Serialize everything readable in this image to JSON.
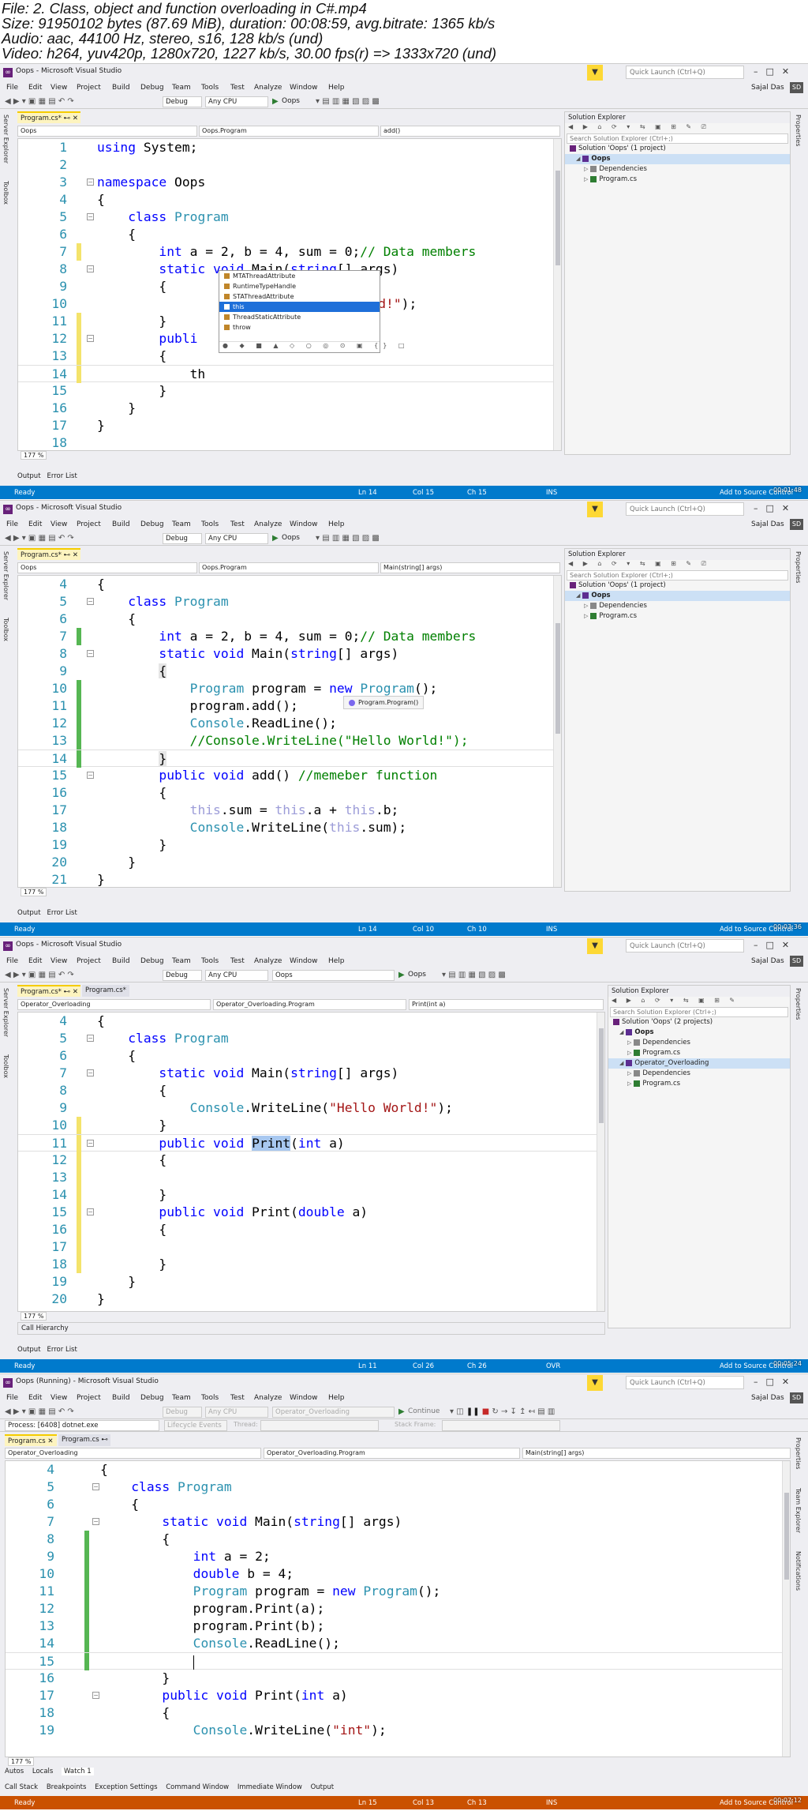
{
  "header": {
    "file": "File: 2. Class, object and function overloading in C#.mp4",
    "size": "Size: 91950102 bytes (87.69 MiB), duration: 00:08:59, avg.bitrate: 1365 kb/s",
    "audio": "Audio: aac, 44100 Hz, stereo, s16, 128 kb/s (und)",
    "video": "Video: h264, yuv420p, 1280x720, 1227 kb/s, 30.00 fps(r) => 1333x720 (und)"
  },
  "common": {
    "menu": [
      "File",
      "Edit",
      "View",
      "Project",
      "Build",
      "Debug",
      "Team",
      "Tools",
      "Test",
      "Analyze",
      "Window",
      "Help"
    ],
    "quick_launch": "Quick Launch (Ctrl+Q)",
    "user": "Sajal Das",
    "user_initials": "SD",
    "debug_config": "Debug",
    "platform": "Any CPU",
    "side_left": [
      "Server Explorer",
      "Toolbox"
    ],
    "side_right": [
      "Properties"
    ],
    "side_right_running": [
      "Properties",
      "Team Explorer",
      "Notifications"
    ],
    "se_title": "Solution Explorer",
    "se_search": "Search Solution Explorer (Ctrl+;)",
    "output_tab": "Output",
    "errorlist_tab": "Error List",
    "zoom": "177 %",
    "icons": [
      "vs-logo-icon",
      "filter-icon",
      "minimize-icon",
      "maximize-icon",
      "close-icon",
      "fold-icon"
    ],
    "colors": {
      "keyword": "#0000ff",
      "type": "#2b91af",
      "string": "#a31515",
      "comment": "#008000",
      "status_blue": "#007acc",
      "status_orange": "#ca5100"
    }
  },
  "frames": [
    {
      "title": "Oops - Microsoft Visual Studio",
      "start_target": "Oops",
      "tabs": [
        "Program.cs*"
      ],
      "nav": [
        "Oops",
        "Oops.Program",
        "add()"
      ],
      "solution": [
        "Solution 'Oops' (1 project)",
        "Oops",
        "Dependencies",
        "Program.cs"
      ],
      "status": {
        "state": "Ready",
        "ln": "Ln 14",
        "col": "Col 15",
        "ch": "Ch 15",
        "mode": "INS",
        "source": "Add to Source Control"
      },
      "timestamp": "00:01:48",
      "intellisense": [
        "MTAThreadAttribute",
        "RuntimeTypeHandle",
        "STAThreadAttribute",
        "this",
        "ThreadStaticAttribute",
        "throw"
      ]
    },
    {
      "title": "Oops - Microsoft Visual Studio",
      "start_target": "Oops",
      "tabs": [
        "Program.cs*"
      ],
      "nav": [
        "Oops",
        "Oops.Program",
        "Main(string[] args)"
      ],
      "solution": [
        "Solution 'Oops' (1 project)",
        "Oops",
        "Dependencies",
        "Program.cs"
      ],
      "status": {
        "state": "Ready",
        "ln": "Ln 14",
        "col": "Col 10",
        "ch": "Ch 10",
        "mode": "INS",
        "source": "Add to Source Control"
      },
      "timestamp": "00:03:36",
      "tooltip": "Program.Program()"
    },
    {
      "title": "Oops - Microsoft Visual Studio",
      "start_target": "Oops",
      "tabs": [
        "Program.cs*",
        "Program.cs*"
      ],
      "nav": [
        "Operator_Overloading",
        "Operator_Overloading.Program",
        "Print(int a)"
      ],
      "solution": [
        "Solution 'Oops' (2 projects)",
        "Oops",
        "Dependencies",
        "Program.cs",
        "Operator_Overloading",
        "Dependencies",
        "Program.cs"
      ],
      "status": {
        "state": "Ready",
        "ln": "Ln 11",
        "col": "Col 26",
        "ch": "Ch 26",
        "mode": "OVR",
        "source": "Add to Source Control"
      },
      "timestamp": "00:05:24",
      "call_hierarchy": "Call Hierarchy"
    },
    {
      "title": "Oops (Running) - Microsoft Visual Studio",
      "start_target": "Operator_Overloading",
      "continue": "Continue",
      "process": "Process: [6408] dotnet.exe",
      "lifecycle": "Lifecycle Events",
      "thread": "Thread:",
      "stack_frame": "Stack Frame:",
      "tabs": [
        "Program.cs",
        "Program.cs"
      ],
      "nav": [
        "Operator_Overloading",
        "Operator_Overloading.Program",
        "Main(string[] args)"
      ],
      "watch_tabs": [
        "Autos",
        "Locals",
        "Watch 1"
      ],
      "debug_tabs": [
        "Call Stack",
        "Breakpoints",
        "Exception Settings",
        "Command Window",
        "Immediate Window",
        "Output"
      ],
      "status": {
        "state": "Ready",
        "ln": "Ln 15",
        "col": "Col 13",
        "ch": "Ch 13",
        "mode": "INS",
        "source": "Add to Source Control"
      },
      "timestamp": "00:07:12"
    }
  ]
}
